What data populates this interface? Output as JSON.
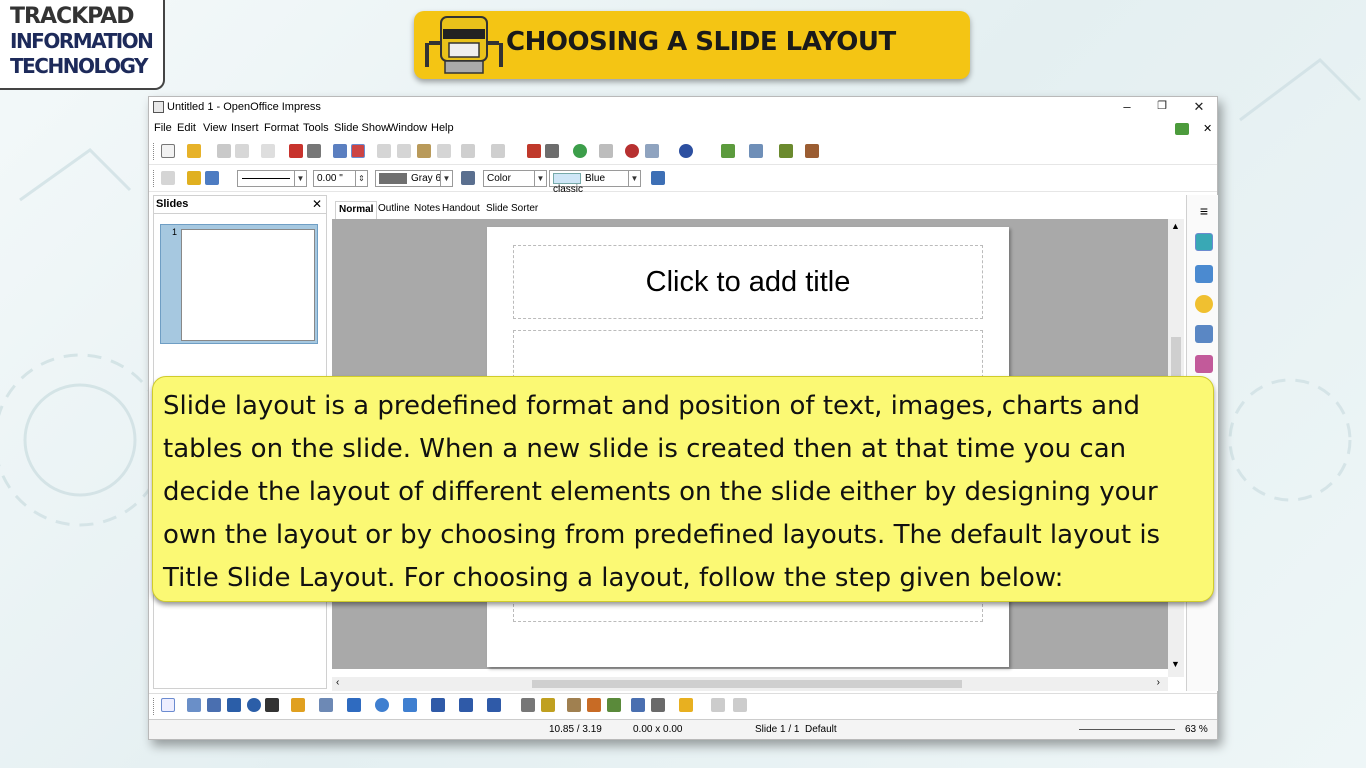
{
  "logo": {
    "line1": "TRACKPAD",
    "line2": "INFORMATION",
    "line3": "TECHNOLOGY"
  },
  "banner": {
    "title": "CHOOSING A SLIDE LAYOUT"
  },
  "window": {
    "title": "Untitled 1 - OpenOffice Impress",
    "controls": {
      "minimize": "–",
      "maximize": "❐",
      "close": "✕"
    }
  },
  "menu": [
    "File",
    "Edit",
    "View",
    "Insert",
    "Format",
    "Tools",
    "Slide Show",
    "Window",
    "Help"
  ],
  "line_toolbar": {
    "line_width": "0.00 \"",
    "line_color": "Gray 6",
    "area_style": "Color",
    "area_color": "Blue classic",
    "colors": {
      "gray6": "#6f6f6f",
      "blue_classic": "#cfe6f7"
    }
  },
  "slides_pane": {
    "header": "Slides",
    "close": "✕",
    "thumb_number": "1"
  },
  "view_tabs": [
    "Normal",
    "Outline",
    "Notes",
    "Handout",
    "Slide Sorter"
  ],
  "slide": {
    "title_placeholder": "Click to add title"
  },
  "status": {
    "position": "10.85 / 3.19",
    "size": "0.00 x 0.00",
    "slide": "Slide 1 / 1",
    "master": "Default",
    "zoom": "63 %"
  },
  "note": {
    "text": "Slide layout is a predefined format and position of text, images, charts and tables on the slide. When a new slide is created then at that time you can decide the layout of different elements on the slide either by designing your own the layout or by choosing from predefined layouts. The default layout is Title Slide Layout. For choosing a layout, follow the step given below:"
  },
  "theme": {
    "banner_bg": "#f4c514",
    "note_bg": "#fbf974",
    "canvas_bg": "#a9a9a9"
  }
}
